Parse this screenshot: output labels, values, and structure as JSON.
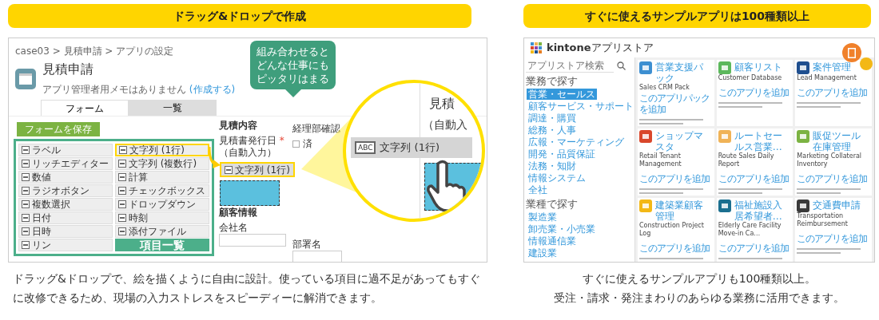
{
  "left_panel": {
    "header": "ドラッグ&ドロップで作成",
    "breadcrumb": "case03 > 見積申請 > アプリの設定",
    "app_title": "見積申請",
    "memo": "アプリ管理者用メモはありません",
    "memo_link": "(作成する)",
    "tabs": [
      {
        "label": "フォーム",
        "selected": true
      },
      {
        "label": "一覧",
        "selected": false
      }
    ],
    "save_button": "フォームを保存",
    "palette": [
      {
        "label": "ラベル",
        "highlighted": false
      },
      {
        "label": "文字列 (1行)",
        "highlighted": true
      },
      {
        "label": "リッチエディター",
        "highlighted": false
      },
      {
        "label": "文字列 (複数行)",
        "highlighted": false
      },
      {
        "label": "数値",
        "highlighted": false
      },
      {
        "label": "計算",
        "highlighted": false
      },
      {
        "label": "ラジオボタン",
        "highlighted": false
      },
      {
        "label": "チェックボックス",
        "highlighted": false
      },
      {
        "label": "複数選択",
        "highlighted": false
      },
      {
        "label": "ドロップダウン",
        "highlighted": false
      },
      {
        "label": "日付",
        "highlighted": false
      },
      {
        "label": "時刻",
        "highlighted": false
      },
      {
        "label": "日時",
        "highlighted": false
      },
      {
        "label": "添付ファイル",
        "highlighted": false
      },
      {
        "label": "リン",
        "highlighted": false
      }
    ],
    "palette_badge": "項目一覧",
    "form": {
      "section_1": "見積内容",
      "date_label": "見積書発行日",
      "required_mark": "*",
      "date_value": "（自動入力）",
      "check_label": "経理部確認",
      "check_option": "済",
      "section_2": "顧客情報",
      "fields": [
        "会社名",
        "部署名"
      ]
    },
    "dragged_item": "文字列 (1行)",
    "callout": [
      "組み合わせると",
      "どんな仕事にも",
      "ピッタリはまる"
    ],
    "magnifier": {
      "field_icon": "ABC",
      "item": "文字列 (1行)",
      "texts": [
        "見積",
        "（自動入"
      ]
    },
    "caption": "ドラッグ&ドロップで、絵を描くように自由に設計。使っている項目に過不足があってもすぐに改修できるため、現場の入力ストレスをスピーディーに解消できます。"
  },
  "right_panel": {
    "header": "すぐに使えるサンプルアプリは100種類以上",
    "store_title": "**kintone**アプリストア",
    "search": {
      "placeholder": "アプリストア検索"
    },
    "sidebar": [
      {
        "heading": "業務で探す",
        "items": [
          {
            "label": "営業・セールス",
            "selected": true
          },
          {
            "label": "顧客サービス・サポート",
            "selected": false
          },
          {
            "label": "調達・購買",
            "selected": false
          },
          {
            "label": "総務・人事",
            "selected": false
          },
          {
            "label": "広報・マーケティング",
            "selected": false
          },
          {
            "label": "開発・品質保証",
            "selected": false
          },
          {
            "label": "法務・知財",
            "selected": false
          },
          {
            "label": "情報システム",
            "selected": false
          },
          {
            "label": "全社",
            "selected": false
          }
        ]
      },
      {
        "heading": "業種で探す",
        "items": [
          {
            "label": "製造業",
            "selected": false
          },
          {
            "label": "卸売業・小売業",
            "selected": false
          },
          {
            "label": "情報通信業",
            "selected": false
          },
          {
            "label": "建設業",
            "selected": false
          }
        ]
      }
    ],
    "cards": [
      {
        "title": "営業支援パック",
        "subtitle": "Sales CRM Pack",
        "link": "このアプリパックを追加",
        "color": "#3d8fd1"
      },
      {
        "title": "顧客リスト",
        "subtitle": "Customer Database",
        "link": "このアプリを追加",
        "color": "#5cb85c"
      },
      {
        "title": "案件管理",
        "subtitle": "Lead Management",
        "link": "このアプリを追加",
        "color": "#1f4f8f"
      },
      {
        "title": "ショップマスタ",
        "subtitle": "Retail Tenant Management",
        "link": "このアプリを追加",
        "color": "#d9472b"
      },
      {
        "title": "ルートセールス営業…",
        "subtitle": "Route Sales Daily Report",
        "link": "このアプリを追加",
        "color": "#f0b357"
      },
      {
        "title": "販促ツール在庫管理",
        "subtitle": "Marketing Collateral Inventory",
        "link": "このアプリを追加",
        "color": "#7cb342"
      },
      {
        "title": "建築業顧客管理",
        "subtitle": "Construction Project Log",
        "link": "このアプリを追加",
        "color": "#f3b816"
      },
      {
        "title": "福祉施設入居希望者…",
        "subtitle": "Elderly Care Facility Move-in Ca…",
        "link": "このアプリを追加",
        "color": "#1b6f8f"
      },
      {
        "title": "交通費申請",
        "subtitle": "Transportation Reimbursement",
        "link": "このアプリを追加",
        "color": "#3a3a3a"
      }
    ],
    "caption": [
      "すぐに使えるサンプルアプリも100種類以上。",
      "受注・請求・発注まわりのあらゆる業務に活用できます。"
    ]
  }
}
